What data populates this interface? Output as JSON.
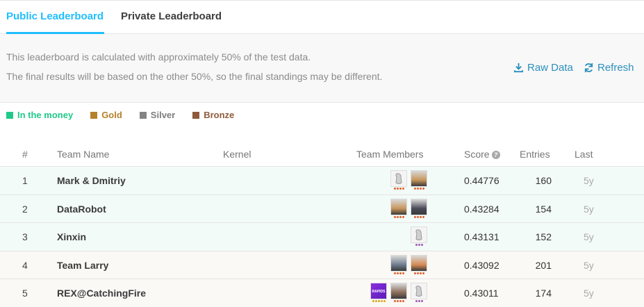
{
  "tabs": {
    "public": "Public Leaderboard",
    "private": "Private Leaderboard"
  },
  "info": {
    "line1": "This leaderboard is calculated with approximately 50% of the test data.",
    "line2": "The final results will be based on the other 50%, so the final standings may be different.",
    "raw_data": "Raw Data",
    "refresh": "Refresh"
  },
  "legend": {
    "money": "In the money",
    "gold": "Gold",
    "silver": "Silver",
    "bronze": "Bronze"
  },
  "colors": {
    "accent": "#20beff",
    "money": "#20c98a",
    "gold": "#b5812c",
    "silver": "#838383",
    "bronze": "#8e5a3a"
  },
  "headers": {
    "rank": "#",
    "team": "Team Name",
    "kernel": "Kernel",
    "members": "Team Members",
    "score": "Score",
    "entries": "Entries",
    "last": "Last"
  },
  "rows": [
    {
      "rank": "1",
      "team": "Mark & Dmitriy",
      "score": "0.44776",
      "entries": "160",
      "last": "5y",
      "medal": "money",
      "members": [
        "default-avatar",
        "photo-avatar"
      ]
    },
    {
      "rank": "2",
      "team": "DataRobot",
      "score": "0.43284",
      "entries": "154",
      "last": "5y",
      "medal": "money",
      "members": [
        "photo-avatar",
        "photo-avatar"
      ]
    },
    {
      "rank": "3",
      "team": "Xinxin",
      "score": "0.43131",
      "entries": "152",
      "last": "5y",
      "medal": "money",
      "members": [
        "default-avatar"
      ]
    },
    {
      "rank": "4",
      "team": "Team Larry",
      "score": "0.43092",
      "entries": "201",
      "last": "5y",
      "medal": "gold",
      "members": [
        "photo-avatar",
        "photo-avatar"
      ]
    },
    {
      "rank": "5",
      "team": "REX@CatchingFire",
      "score": "0.43011",
      "entries": "174",
      "last": "5y",
      "medal": "gold",
      "members": [
        "logo-avatar",
        "photo-avatar",
        "default-avatar"
      ]
    }
  ]
}
